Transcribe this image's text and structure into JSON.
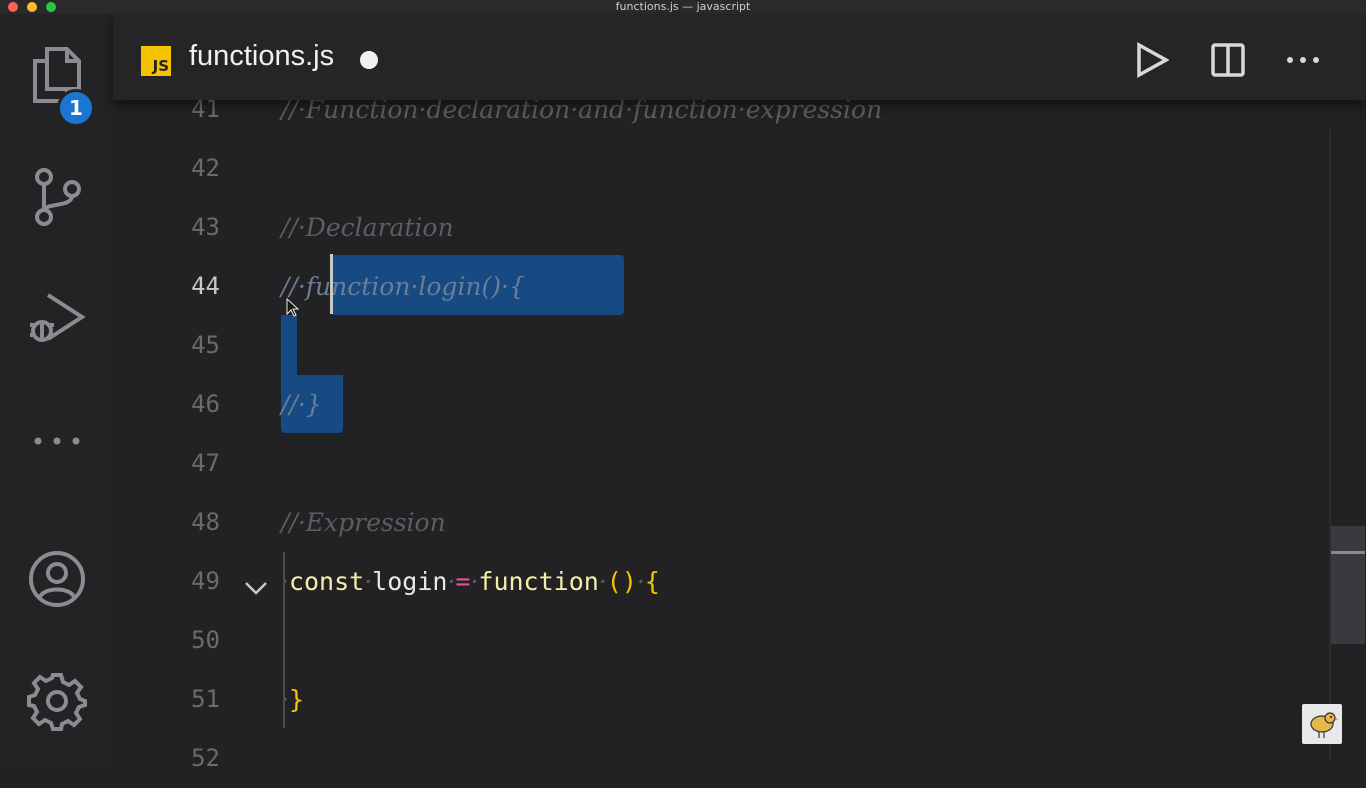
{
  "window": {
    "title": "functions.js — javascript"
  },
  "activity_bar": {
    "items": [
      {
        "name": "explorer",
        "icon": "files-icon",
        "badge": "1"
      },
      {
        "name": "source-control",
        "icon": "source-control-icon"
      },
      {
        "name": "run-and-debug",
        "icon": "run-debug-icon"
      },
      {
        "name": "more",
        "icon": "ellipsis-icon"
      },
      {
        "name": "accounts",
        "icon": "account-icon"
      },
      {
        "name": "manage",
        "icon": "gear-icon"
      }
    ]
  },
  "tab": {
    "filename": "functions.js",
    "language_badge": "JS",
    "dirty": true
  },
  "toolbar": {
    "run_icon": "play-icon",
    "split_icon": "split-editor-icon",
    "more_icon": "ellipsis-icon"
  },
  "editor": {
    "active_line": "44",
    "lines": [
      {
        "num": "41",
        "text": "//·Function·declaration·and·function·expression"
      },
      {
        "num": "42",
        "text": ""
      },
      {
        "num": "43",
        "text": "//·Declaration"
      },
      {
        "num": "44",
        "text": "//·function·login()·{"
      },
      {
        "num": "45",
        "text": ""
      },
      {
        "num": "46",
        "text": "//·}"
      },
      {
        "num": "47",
        "text": ""
      },
      {
        "num": "48",
        "text": "//·Expression"
      },
      {
        "num": "49",
        "tokens": [
          "·",
          "const",
          "·",
          "login",
          "·",
          "=",
          "·",
          "function",
          "·",
          "()",
          "·",
          "{"
        ]
      },
      {
        "num": "50",
        "text": ""
      },
      {
        "num": "51",
        "tokens": [
          "·",
          "}"
        ]
      },
      {
        "num": "52",
        "text": ""
      }
    ]
  },
  "colors": {
    "selection": "#174a82",
    "keyword": "#f3f0a6",
    "operator": "#e84e9a",
    "bracket": "#f7c400",
    "badge": "#1a76d2",
    "js": "#f5c400"
  }
}
